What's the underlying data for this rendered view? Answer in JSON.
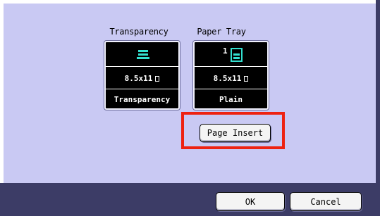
{
  "trays": [
    {
      "label": "Transparency",
      "icon": "stacked-sheets-icon",
      "tray_number": "",
      "size": "8.5x11",
      "type": "Transparency"
    },
    {
      "label": "Paper Tray",
      "icon": "paper-tray-icon",
      "tray_number": "1",
      "size": "8.5x11",
      "type": "Plain"
    }
  ],
  "buttons": {
    "page_insert": "Page Insert",
    "ok": "OK",
    "cancel": "Cancel"
  },
  "colors": {
    "panel": "#c9c9f3",
    "frame": "#3c3c66",
    "icon_accent": "#33e0d0",
    "highlight": "#ee2211"
  }
}
